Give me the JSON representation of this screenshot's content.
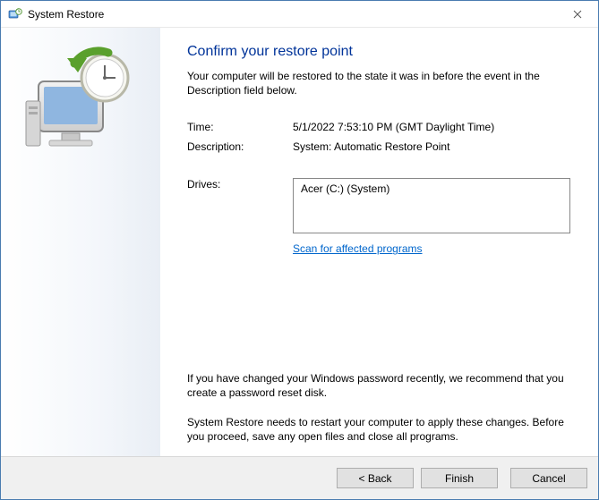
{
  "window": {
    "title": "System Restore"
  },
  "main": {
    "heading": "Confirm your restore point",
    "subtext": "Your computer will be restored to the state it was in before the event in the Description field below."
  },
  "fields": {
    "time_label": "Time:",
    "time_value": "5/1/2022 7:53:10 PM (GMT Daylight Time)",
    "desc_label": "Description:",
    "desc_value": "System: Automatic Restore Point",
    "drives_label": "Drives:",
    "drives_value": "Acer (C:) (System)"
  },
  "links": {
    "scan": "Scan for affected programs"
  },
  "notes": {
    "password": "If you have changed your Windows password recently, we recommend that you create a password reset disk.",
    "restart": "System Restore needs to restart your computer to apply these changes. Before you proceed, save any open files and close all programs."
  },
  "buttons": {
    "back": "< Back",
    "finish": "Finish",
    "cancel": "Cancel"
  }
}
